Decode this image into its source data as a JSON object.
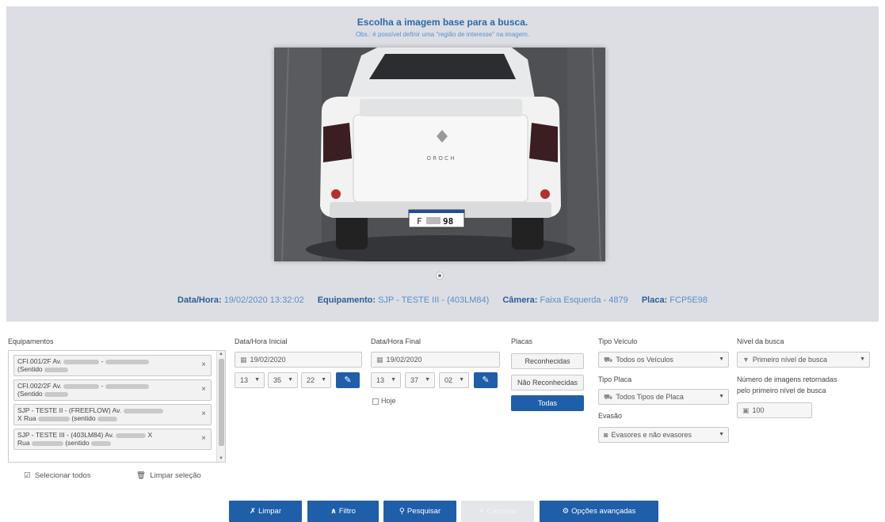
{
  "viewer": {
    "title": "Escolha a imagem base para a busca.",
    "note": "Obs.: é possível definir uma \"região de interesse\" na imagem.",
    "plate_left": "F",
    "plate_right": "98",
    "car_brand": "O R O C H"
  },
  "info": {
    "datetime_label": "Data/Hora:",
    "datetime_value": "19/02/2020 13:32:02",
    "equipment_label": "Equipamento:",
    "equipment_value": "SJP - TESTE III - (403LM84)",
    "camera_label": "Câmera:",
    "camera_value": "Faixa Esquerda - 4879",
    "plate_label": "Placa:",
    "plate_value": "FCP5E98"
  },
  "equipments": {
    "label": "Equipamentos",
    "items": [
      {
        "line1": "CFI.001/2F Av.",
        "line1_tail": "-",
        "line2": "(Sentido"
      },
      {
        "line1": "CFI.002/2F Av.",
        "line1_tail": "-",
        "line2": "(Sentido"
      },
      {
        "line1": "SJP - TESTE II - (FREEFLOW) Av.",
        "line1_tail": "",
        "line2": "X Rua",
        "line2_tail": "(sentido"
      },
      {
        "line1": "SJP - TESTE III - (403LM84) Av.",
        "line1_tail": "X",
        "line2": "Rua",
        "line2_tail": "(sentido"
      }
    ],
    "remove_glyph": "×",
    "select_all": "Selecionar todos",
    "clear_selection": "Limpar seleção"
  },
  "start": {
    "label": "Data/Hora Inicial",
    "date": "19/02/2020",
    "hour": "13",
    "minute": "35",
    "second": "22"
  },
  "end": {
    "label": "Data/Hora Final",
    "date": "19/02/2020",
    "hour": "13",
    "minute": "37",
    "second": "02",
    "today_label": "Hoje"
  },
  "plates": {
    "label": "Placas",
    "options": [
      "Reconhecidas",
      "Não Reconhecidas",
      "Todas"
    ],
    "selected": "Todas"
  },
  "vehicle": {
    "type_label": "Tipo Veículo",
    "type_value": "Todos os Veículos",
    "plate_type_label": "Tipo Placa",
    "plate_type_value": "Todos Tipos de Placa",
    "evasion_label": "Evasão",
    "evasion_value": "Evasores e não evasores"
  },
  "search_level": {
    "label": "Nível da busca",
    "value": "Primeiro nível de busca",
    "count_label_1": "Número de imagens retornadas",
    "count_label_2": "pelo primeiro nível de busca",
    "count_value": "100"
  },
  "actions": {
    "clear": "Limpar",
    "filter": "Filtro",
    "search": "Pesquisar",
    "cancel": "Cancelar",
    "advanced": "Opções avançadas"
  },
  "colors": {
    "primary": "#1f5ea8",
    "link": "#2c5e94",
    "viewer_bg": "#dcdee4"
  }
}
